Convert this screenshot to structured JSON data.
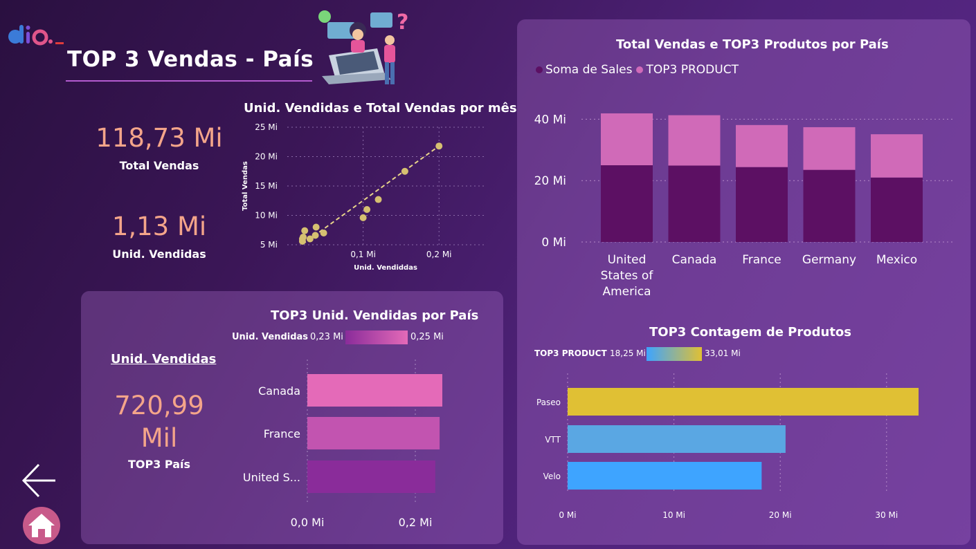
{
  "header": {
    "title": "TOP 3 Vendas - País"
  },
  "kpis": {
    "total_vendas_value": "118,73 Mi",
    "total_vendas_label": "Total Vendas",
    "unid_vendidas_value": "1,13 Mi",
    "unid_vendidas_label": "Unid. Vendidas"
  },
  "scatter": {
    "title": "Unid. Vendidas e Total Vendas por mês",
    "ylabel": "Total Vendas",
    "xlabel": "Unid. Vendiddas",
    "yticks": [
      "5 Mi",
      "10 Mi",
      "15 Mi",
      "20 Mi",
      "25 Mi"
    ],
    "xticks": [
      "0,1 Mi",
      "0,2 Mi"
    ]
  },
  "top3_panel": {
    "title": "TOP3 Unid. Vendidas por País",
    "legend_label": "Unid. Vendidas",
    "legend_min": "0,23 Mi",
    "legend_max": "0,25 Mi",
    "kpi_header": "Unid. Vendidas",
    "kpi_value": "720,99 Mil",
    "kpi_value_line1": "720,99",
    "kpi_value_line2": "Mil",
    "kpi_label": "TOP3 País",
    "xticks": [
      "0,0 Mi",
      "0,2 Mi"
    ],
    "categories": [
      "Canada",
      "France",
      "United S..."
    ]
  },
  "stacked_panel": {
    "title": "Total Vendas e TOP3 Produtos por País",
    "legend": [
      "Soma de  Sales",
      "TOP3 PRODUCT"
    ],
    "yticks": [
      "0 Mi",
      "20 Mi",
      "40 Mi"
    ],
    "categories_lines": [
      [
        "United",
        "States of",
        "America"
      ],
      [
        "Canada"
      ],
      [
        "France"
      ],
      [
        "Germany"
      ],
      [
        "Mexico"
      ]
    ]
  },
  "contagem_panel": {
    "title": "TOP3 Contagem de Produtos",
    "legend_label": "TOP3 PRODUCT",
    "legend_min": "18,25 Mi",
    "legend_max": "33,01 Mi",
    "xticks": [
      "0 Mi",
      "10 Mi",
      "20 Mi",
      "30 Mi"
    ],
    "categories": [
      "Paseo",
      "VTT",
      "Velo"
    ]
  },
  "colors": {
    "dark_bar": "#5c1063",
    "pink_bar": "#d06ab8",
    "kpi_orange": "#f4a58a",
    "gold": "#e0c034",
    "sky": "#5aa7e3",
    "blue": "#3ea4ff"
  },
  "chart_data": [
    {
      "type": "scatter",
      "title": "Unid. Vendidas e Total Vendas por mês",
      "xlabel": "Unid. Vendiddas",
      "ylabel": "Total Vendas",
      "x_unit": "Mi",
      "y_unit": "Mi",
      "xlim": [
        0.0,
        0.26
      ],
      "ylim": [
        5,
        25
      ],
      "trendline": true,
      "points": [
        {
          "x": 0.02,
          "y": 5.6
        },
        {
          "x": 0.02,
          "y": 6.0
        },
        {
          "x": 0.021,
          "y": 6.3
        },
        {
          "x": 0.023,
          "y": 7.4
        },
        {
          "x": 0.03,
          "y": 6.0
        },
        {
          "x": 0.037,
          "y": 6.6
        },
        {
          "x": 0.038,
          "y": 8.0
        },
        {
          "x": 0.048,
          "y": 7.0
        },
        {
          "x": 0.1,
          "y": 9.6
        },
        {
          "x": 0.105,
          "y": 11.0
        },
        {
          "x": 0.12,
          "y": 12.7
        },
        {
          "x": 0.155,
          "y": 17.5
        },
        {
          "x": 0.2,
          "y": 21.8
        }
      ]
    },
    {
      "type": "bar",
      "orientation": "horizontal",
      "title": "TOP3 Unid. Vendidas por País",
      "unit": "Mi",
      "categories": [
        "Canada",
        "France",
        "United S..."
      ],
      "values": [
        0.25,
        0.245,
        0.237
      ],
      "xlim": [
        0,
        0.25
      ]
    },
    {
      "type": "bar",
      "stacked": true,
      "title": "Total Vendas e TOP3 Produtos por País",
      "unit": "Mi",
      "categories": [
        "United States of America",
        "Canada",
        "France",
        "Germany",
        "Mexico"
      ],
      "series": [
        {
          "name": "Soma de  Sales",
          "values": [
            25.0,
            24.9,
            24.4,
            23.5,
            21.0
          ]
        },
        {
          "name": "TOP3 PRODUCT",
          "values": [
            16.9,
            16.4,
            13.7,
            13.9,
            14.1
          ]
        }
      ],
      "ylim": [
        0,
        45
      ],
      "legend": "top-left"
    },
    {
      "type": "bar",
      "orientation": "horizontal",
      "title": "TOP3 Contagem de Produtos",
      "unit": "Mi",
      "categories": [
        "Paseo",
        "VTT",
        "Velo"
      ],
      "values": [
        33.01,
        20.5,
        18.25
      ],
      "xlim": [
        0,
        35
      ]
    }
  ]
}
